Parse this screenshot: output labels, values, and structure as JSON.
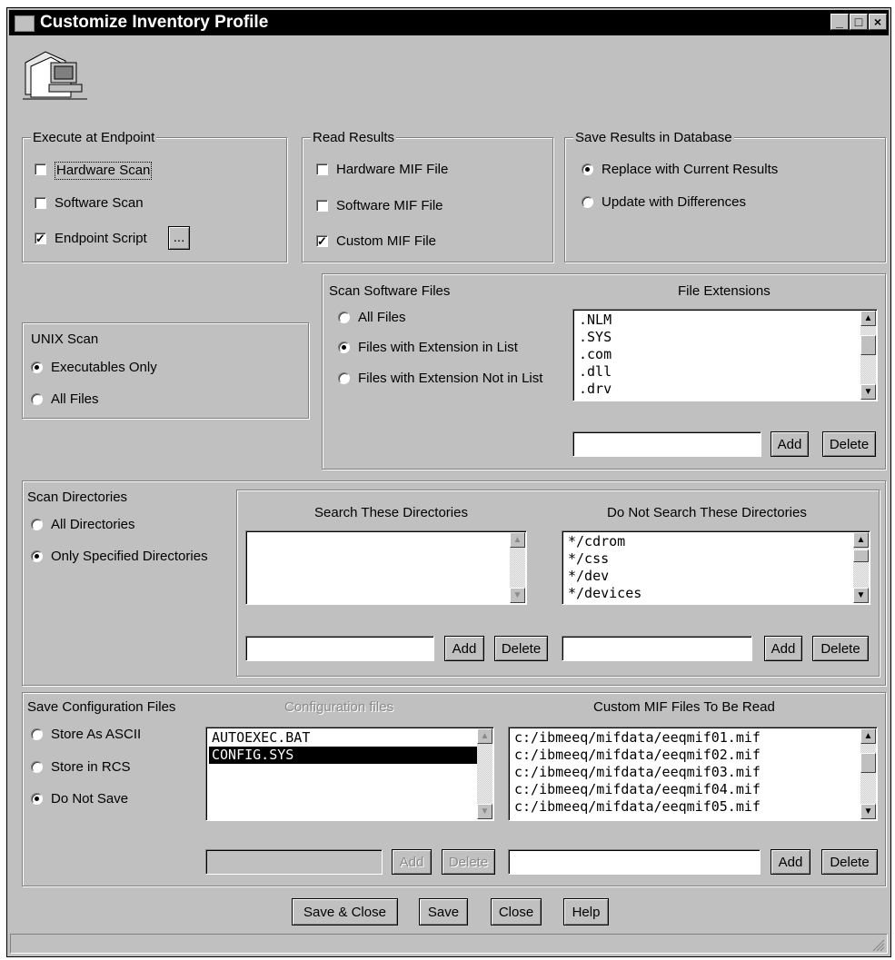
{
  "window": {
    "title": "Customize Inventory Profile",
    "minimize": "_",
    "maximize": "□",
    "close": "×"
  },
  "execute_at_endpoint": {
    "title": "Execute at Endpoint",
    "hardware_scan": {
      "label": "Hardware Scan",
      "checked": false
    },
    "software_scan": {
      "label": "Software Scan",
      "checked": false
    },
    "endpoint_script": {
      "label": "Endpoint Script",
      "checked": true,
      "browse": "..."
    }
  },
  "read_results": {
    "title": "Read Results",
    "hardware_mif": {
      "label": "Hardware MIF File",
      "checked": false
    },
    "software_mif": {
      "label": "Software MIF File",
      "checked": false
    },
    "custom_mif": {
      "label": "Custom MIF File",
      "checked": true
    }
  },
  "save_results": {
    "title": "Save Results in Database",
    "replace": "Replace with Current Results",
    "update": "Update with Differences",
    "selected": "replace"
  },
  "unix_scan": {
    "title": "UNIX Scan",
    "executables": "Executables Only",
    "all_files": "All Files",
    "selected": "executables"
  },
  "scan_software": {
    "title": "Scan Software Files",
    "all_files": "All Files",
    "with_ext": "Files with Extension in List",
    "without_ext": "Files with Extension Not in List",
    "selected": "with_ext",
    "ext_header": "File Extensions",
    "extensions": [
      ".NLM",
      ".SYS",
      ".com",
      ".dll",
      ".drv"
    ],
    "add": "Add",
    "delete": "Delete",
    "input_value": ""
  },
  "scan_directories": {
    "title": "Scan Directories",
    "all": "All Directories",
    "specified": "Only Specified Directories",
    "selected": "specified",
    "search_header": "Search These Directories",
    "search_list": [],
    "exclude_header": "Do Not Search These Directories",
    "exclude_list": [
      "*/cdrom",
      "*/css",
      "*/dev",
      "*/devices"
    ],
    "add": "Add",
    "delete": "Delete"
  },
  "config_files": {
    "title": "Save Configuration Files",
    "ascii": "Store As ASCII",
    "rcs": "Store in RCS",
    "nosave": "Do Not Save",
    "selected": "nosave",
    "list_header": "Configuration files",
    "files": [
      "AUTOEXEC.BAT",
      "CONFIG.SYS"
    ],
    "selected_file": "CONFIG.SYS",
    "custom_header": "Custom MIF Files To Be Read",
    "custom_files": [
      "c:/ibmeeq/mifdata/eeqmif01.mif",
      "c:/ibmeeq/mifdata/eeqmif02.mif",
      "c:/ibmeeq/mifdata/eeqmif03.mif",
      "c:/ibmeeq/mifdata/eeqmif04.mif",
      "c:/ibmeeq/mifdata/eeqmif05.mif"
    ],
    "add": "Add",
    "delete": "Delete"
  },
  "footer": {
    "save_close": "Save & Close",
    "save": "Save",
    "close": "Close",
    "help": "Help"
  },
  "status_text": ""
}
